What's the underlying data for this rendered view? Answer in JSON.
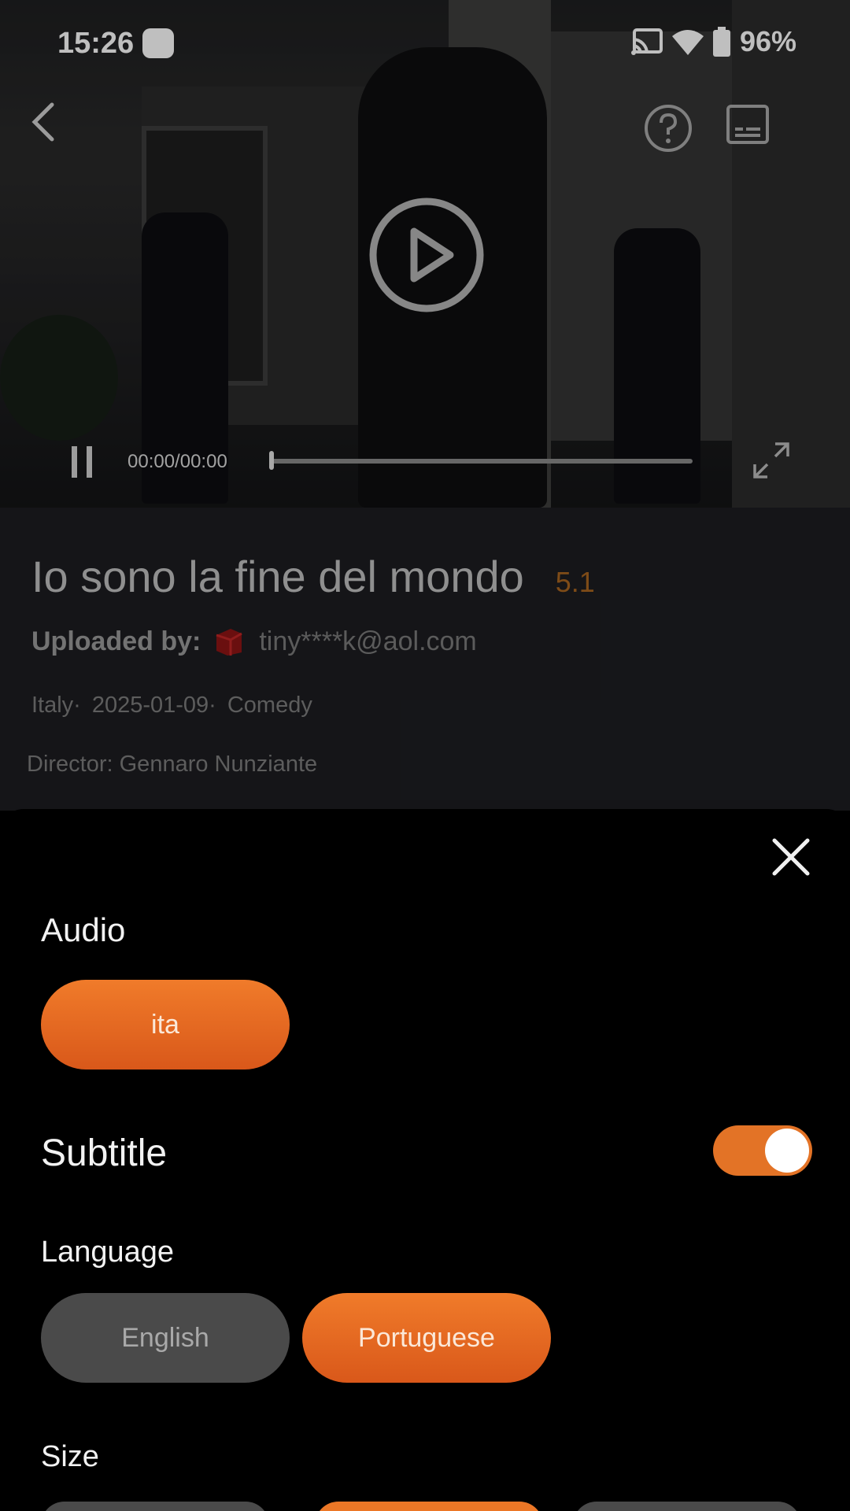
{
  "status_bar": {
    "time": "15:26",
    "battery": "96%",
    "icons": [
      "cast-icon",
      "wifi-icon",
      "battery-icon"
    ]
  },
  "player": {
    "time_display": "00:00/00:00",
    "progress": 0,
    "icons": {
      "back": "chevron-left-icon",
      "help": "help-icon",
      "subtitles": "subtitles-icon",
      "play": "play-icon",
      "pause": "pause-icon",
      "fullscreen": "fullscreen-icon"
    }
  },
  "movie": {
    "title": "Io sono la fine del mondo",
    "rating": "5.1",
    "uploaded_by_label": "Uploaded by:",
    "uploader_email": "tiny****k@aol.com",
    "country": "Italy·",
    "date": "2025-01-09·",
    "genre": "Comedy",
    "director": "Director: Gennaro Nunziante"
  },
  "sheet": {
    "audio_label": "Audio",
    "audio_options": [
      {
        "label": "ita",
        "selected": true
      }
    ],
    "subtitle_label": "Subtitle",
    "subtitle_enabled": true,
    "language_label": "Language",
    "language_options": [
      {
        "label": "English",
        "selected": false
      },
      {
        "label": "Portuguese",
        "selected": true
      }
    ],
    "size_label": "Size"
  },
  "colors": {
    "accent": "#e37326",
    "rating": "#a9651f",
    "pill_inactive": "#4a4a4a",
    "background": "#000000"
  }
}
